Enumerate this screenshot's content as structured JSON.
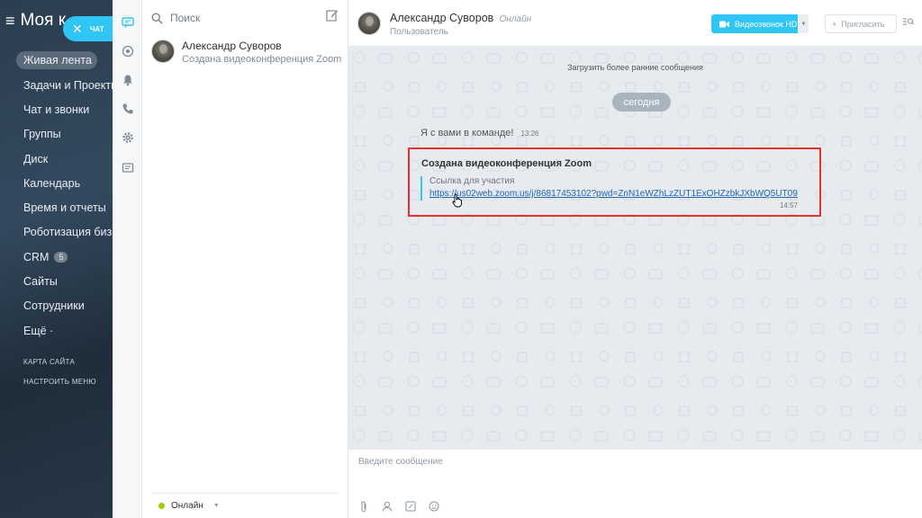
{
  "leftnav": {
    "brand": "Моя к",
    "items": [
      {
        "label": "Живая лента"
      },
      {
        "label": "Задачи и Проекты"
      },
      {
        "label": "Чат и звонки"
      },
      {
        "label": "Группы"
      },
      {
        "label": "Диск"
      },
      {
        "label": "Календарь"
      },
      {
        "label": "Время и отчеты"
      },
      {
        "label": "Роботизация бизн"
      },
      {
        "label": "CRM",
        "count": "5"
      },
      {
        "label": "Сайты"
      },
      {
        "label": "Сотрудники"
      },
      {
        "label": "Ещё ·"
      }
    ],
    "sitemap": "КАРТА САЙТА",
    "configure": "НАСТРОИТЬ МЕНЮ"
  },
  "chatpill": {
    "label": "ЧАТ"
  },
  "recent": {
    "search_placeholder": "Поиск",
    "items": [
      {
        "name": "Александр Суворов",
        "preview": "Создана видеоконференция Zoom"
      }
    ],
    "status": "Онлайн"
  },
  "chat": {
    "header": {
      "name": "Александр Суворов",
      "presence": "Онлайн",
      "role": "Пользователь",
      "video_button": "Видеозвонок HD",
      "invite_button": "Пригласить"
    },
    "load_more": "Загрузить более ранние сообщения",
    "date_label": "сегодня",
    "system_message": {
      "text": "Я с вами в команде!",
      "time": "13:26"
    },
    "card": {
      "title": "Создана видеоконференция Zoom",
      "quote_label": "Ссылка для участия",
      "link": "https://us02web.zoom.us/j/86817453102?pwd=ZnN1eWZhLzZUT1ExOHZzbkJXbWQ5UT09",
      "time": "14:57"
    },
    "input_placeholder": "Введите сообщение"
  },
  "colors": {
    "accent": "#2fc6f6",
    "highlight": "#e5302f",
    "link": "#2067b0"
  }
}
